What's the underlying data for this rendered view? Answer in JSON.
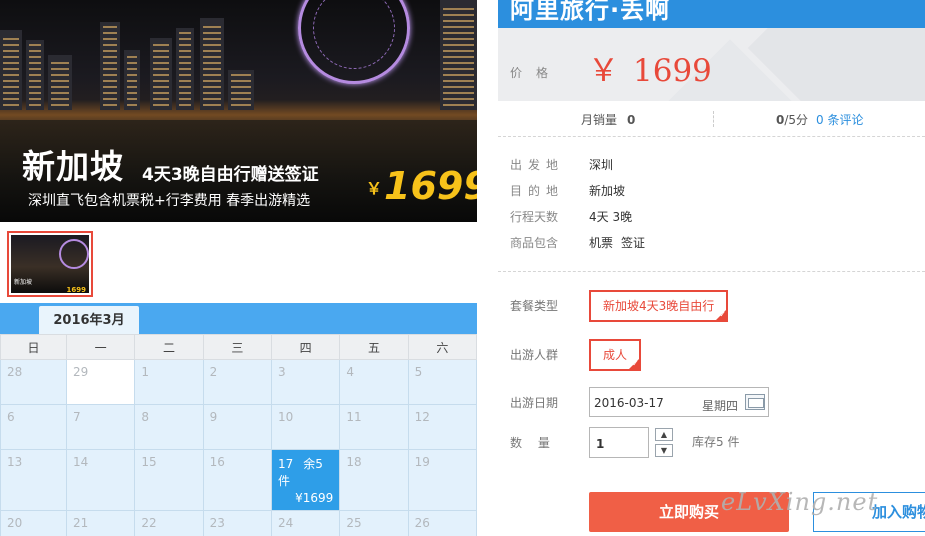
{
  "banner": {
    "title": "新加坡",
    "subtitle": "4天3晚自由行赠送签证",
    "tagline": "深圳直飞包含机票税+行李费用 春季出游精选",
    "currency": "￥",
    "price": "1699"
  },
  "thumbnail": {
    "mini_text": "新加坡",
    "mini_price": "1699"
  },
  "calendar": {
    "month_tab": "2016年3月",
    "weekdays": [
      "日",
      "一",
      "二",
      "三",
      "四",
      "五",
      "六"
    ],
    "weeks": [
      [
        "28",
        "29",
        "1",
        "2",
        "3",
        "4",
        "5"
      ],
      [
        "6",
        "7",
        "8",
        "9",
        "10",
        "11",
        "12"
      ],
      [
        "13",
        "14",
        "15",
        "16",
        "17",
        "18",
        "19"
      ],
      [
        "20",
        "21",
        "22",
        "23",
        "24",
        "25",
        "26"
      ]
    ],
    "selected_day": "17",
    "selected_qty": "余5件",
    "selected_price": "¥1699"
  },
  "product": {
    "title": "阿里旅行·丢啊",
    "price_label": "价格",
    "currency": "￥",
    "price": "1699",
    "monthly_sales_label": "月销量",
    "monthly_sales": "0",
    "rating": "0",
    "rating_suffix": "/5分",
    "reviews_link": "0 条评论",
    "info": [
      {
        "key": "出发地",
        "value": "深圳"
      },
      {
        "key": "目的地",
        "value": "新加坡"
      },
      {
        "key": "行程天数",
        "value": "4天 3晚"
      },
      {
        "key": "商品包含",
        "value": [
          "机票",
          "签证"
        ]
      }
    ],
    "package_label": "套餐类型",
    "package_value": "新加坡4天3晚自由行",
    "traveler_label": "出游人群",
    "traveler_value": "成人",
    "date_label": "出游日期",
    "date_value": "2016-03-17",
    "weekday_value": "星期四",
    "qty_label": "数　 量",
    "qty_value": "1",
    "stock_text": "库存5 件",
    "buy_label": "立即购买",
    "cart_label": "加入购物"
  },
  "watermark": "eLvXing.net",
  "colors": {
    "accent_red": "#e8493a",
    "accent_blue": "#2c8fde",
    "price_yellow": "#f7c21a"
  }
}
